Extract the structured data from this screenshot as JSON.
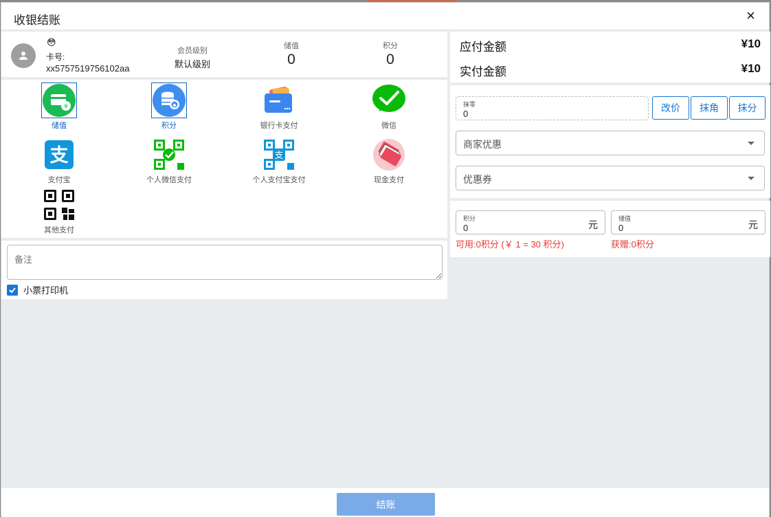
{
  "dialog": {
    "title": "收银结账",
    "close": "×"
  },
  "member": {
    "face": "😳",
    "card_label": "卡号:",
    "card_no": "xx5757519756102aa",
    "level_title": "会员级别",
    "level_value": "默认级别",
    "stored_title": "储值",
    "stored_value": "0",
    "points_title": "积分",
    "points_value": "0"
  },
  "payments": [
    {
      "label": "储值",
      "icon": "stored-value-card-icon",
      "selected": true
    },
    {
      "label": "积分",
      "icon": "points-coins-icon",
      "selected": true
    },
    {
      "label": "银行卡支付",
      "icon": "bank-card-icon"
    },
    {
      "label": "微信",
      "icon": "wechat-icon"
    },
    {
      "label": "支付宝",
      "icon": "alipay-icon"
    },
    {
      "label": "个人微信支付",
      "icon": "wechat-qr-icon"
    },
    {
      "label": "个人支付宝支付",
      "icon": "alipay-qr-icon"
    },
    {
      "label": "现金支付",
      "icon": "cash-icon"
    },
    {
      "label": "其他支付",
      "icon": "qr-code-icon"
    }
  ],
  "remark": {
    "placeholder": "备注"
  },
  "printer": {
    "label": "小票打印机",
    "checked": true
  },
  "amounts": {
    "payable_label": "应付金额",
    "payable_value": "¥10",
    "actual_label": "实付金额",
    "actual_value": "¥10"
  },
  "adjust": {
    "round_label": "抹零",
    "round_value": "0",
    "btn_change_price": "改价",
    "btn_round_jiao": "抹角",
    "btn_round_fen": "抹分",
    "merchant_discount": "商家优惠",
    "coupon": "优惠券"
  },
  "points_pay": {
    "points_label": "积分",
    "points_value": "0",
    "points_unit": "元",
    "stored_label": "储值",
    "stored_value": "0",
    "stored_unit": "元",
    "available_hint": "可用:0积分 (￥ 1 = 30 积分)",
    "gift_hint": "获赠:0积分"
  },
  "footer": {
    "checkout": "结账"
  },
  "colors": {
    "primary": "#1976d2",
    "checkout_button": "#7aabe6",
    "hint_red": "#e53935",
    "wechat_green": "#09bb07",
    "alipay_blue": "#1296db"
  }
}
